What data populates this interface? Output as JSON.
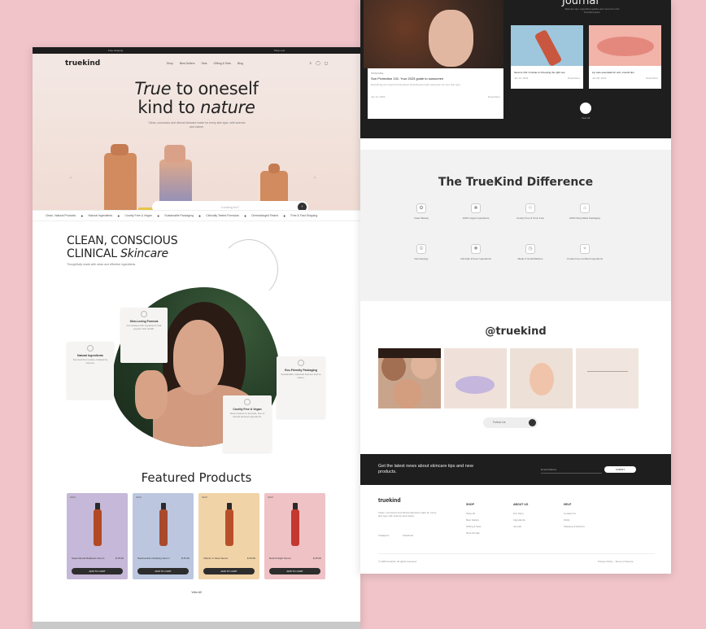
{
  "left_page": {
    "topbar": [
      "Free shipping",
      "Shop now"
    ],
    "nav": {
      "logo": "truekind",
      "links": [
        "Shop",
        "Best Sellers",
        "Sets",
        "Gifting & Sets",
        "Blog"
      ],
      "icons": [
        "search-icon",
        "user-icon",
        "cart-icon"
      ]
    },
    "hero": {
      "line1_italic": "True",
      "line1_rest": " to oneself",
      "line2_start": "kind to ",
      "line2_italic": "nature",
      "subtitle": "Clean, conscious and clinical skincare made for every skin type, with science and nature.",
      "search_placeholder": "Looking for?",
      "search_go": "›",
      "prev_arrow": "‹",
      "next_arrow": "›"
    },
    "marquee": [
      "Clean, Natural Products",
      "Natural Ingredients",
      "Cruelty Free & Vegan",
      "Sustainable Packaging",
      "Clinically Tested Formulas",
      "Dermatologist Tested",
      "Free & Fast Shipping"
    ],
    "section": {
      "line1": "CLEAN, CONSCIOUS",
      "line2_start": "CLINICAL ",
      "line2_italic": "Skincare",
      "subtitle": "Thoughtfully made with clean and effective ingredients."
    },
    "feature_cards": [
      {
        "title": "Skin-Loving Formula",
        "desc": "Formulated with ingredients that support skin health."
      },
      {
        "title": "Natural Ingredients",
        "desc": "Sourced from nature, backed by science."
      },
      {
        "title": "Eco-Friendly Packaging",
        "desc": "Sustainable materials that are kind to nature."
      },
      {
        "title": "Cruelty Free & Vegan",
        "desc": "Never tested on animals, free of animal derived ingredients."
      }
    ],
    "featured_title": "Featured Products",
    "products": [
      {
        "tag": "NEW",
        "name": "Supernatural Radiance Serum",
        "price": "$ 25.00",
        "button": "ADD TO CART",
        "bg": "#c6b8d8",
        "bottle": "#b14a24"
      },
      {
        "tag": "NEW",
        "name": "Niacinamide Clarifying Serum",
        "price": "$ 25.00",
        "button": "ADD TO CART",
        "bg": "#bcc7df",
        "bottle": "#a94a2d"
      },
      {
        "tag": "NEW",
        "name": "Vitamin C Glow Serum",
        "price": "$ 25.00",
        "button": "ADD TO CART",
        "bg": "#f1d3a8",
        "bottle": "#b8502a"
      },
      {
        "tag": "NEW",
        "name": "Retinol Night Serum",
        "price": "$ 25.00",
        "button": "ADD TO CART",
        "bg": "#efc2c5",
        "bottle": "#c3382f"
      }
    ],
    "view_all": "View All"
  },
  "right_page": {
    "journal": {
      "title": "Journal",
      "subtitle": "Skincare tips, ingredient guides and more from the TrueKind team.",
      "main": {
        "category": "SKINCARE",
        "title": "Sun Protection 101: Your 2023 guide to sunscreen",
        "excerpt": "Everything you need to know about choosing the right sunscreen for your skin type.",
        "date": "Jan 12, 2023",
        "link": "Read More"
      },
      "cards": [
        {
          "title": "Serums 101: A Guide to Choosing the right one",
          "date": "Jan 10, 2023",
          "link": "Read More"
        },
        {
          "title": "Lip care essentials for soft, smooth lips",
          "date": "Jan 08, 2023",
          "link": "Read More"
        }
      ],
      "view_all": "View All"
    },
    "difference": {
      "title": "The TrueKind Difference",
      "items": [
        "Clean Beauty",
        "100% Vegan Ingredients",
        "Cruelty Free & Toxin Free",
        "100% Recyclable Packaging",
        "Dermatology",
        "Clinically Proven Ingredients",
        "Made in Small Batches",
        "Cruelty Free Certified Ingredients"
      ]
    },
    "instagram": {
      "handle": "@truekind",
      "button": "Follow Us"
    },
    "newsletter": {
      "text": "Get the latest news about skincare tips and new products.",
      "placeholder": "Email Address",
      "button": "SUBMIT"
    },
    "footer": {
      "logo": "truekind",
      "desc": "Clean, conscious and clinical skincare made for every skin type with science and nature.",
      "social": [
        "Instagram",
        "Facebook"
      ],
      "columns": [
        {
          "title": "SHOP",
          "items": [
            "Shop All",
            "Best Sellers",
            "Gifting & Sets",
            "New Arrivals"
          ]
        },
        {
          "title": "ABOUT US",
          "items": [
            "Our Story",
            "Ingredients",
            "Journal"
          ]
        },
        {
          "title": "HELP",
          "items": [
            "Contact Us",
            "FAQs",
            "Shipping & Returns"
          ]
        }
      ],
      "copyright": "© 2023 truekind. All rights reserved",
      "legal": "Privacy Policy · Terms of Service"
    }
  }
}
